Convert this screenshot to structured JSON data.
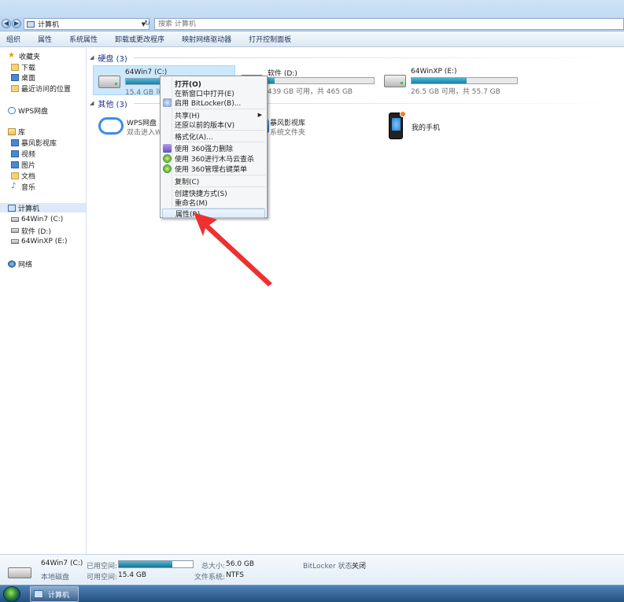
{
  "window": {
    "breadcrumb": "计算机",
    "search_placeholder": "搜索 计算机"
  },
  "toolbar": {
    "items": [
      "组织",
      "属性",
      "系统属性",
      "卸载或更改程序",
      "映射网络驱动器",
      "打开控制面板"
    ]
  },
  "navpane": {
    "favorites": {
      "title": "收藏夹",
      "items": [
        "下载",
        "桌面",
        "最近访问的位置"
      ]
    },
    "wps": "WPS网盘",
    "libraries": {
      "title": "库",
      "items": [
        "暴风影视库",
        "视频",
        "图片",
        "文档",
        "音乐"
      ]
    },
    "computer": {
      "title": "计算机",
      "items": [
        "64Win7 (C:)",
        "软件 (D:)",
        "64WinXP (E:)"
      ]
    },
    "network": "网络"
  },
  "content": {
    "hard_disks_header": "硬盘 (3)",
    "drives": [
      {
        "name": "64Win7 (C:)",
        "free_text": "15.4 GB 可",
        "used_fraction": 0.72
      },
      {
        "name": "软件 (D:)",
        "free_text": "439 GB 可用，共 465 GB",
        "used_fraction": 0.06
      },
      {
        "name": "64WinXP (E:)",
        "free_text": "26.5 GB 可用，共 55.7 GB",
        "used_fraction": 0.52
      }
    ],
    "other_header": "其他 (3)",
    "others": [
      {
        "name": "WPS网盘",
        "sub": "双击进入W"
      },
      {
        "name": "暴风影视库",
        "sub": "系统文件夹"
      },
      {
        "name": "我的手机",
        "sub": ""
      }
    ]
  },
  "context_menu": {
    "items": [
      {
        "label": "打开(O)",
        "bold": true
      },
      {
        "label": "在新窗口中打开(E)"
      },
      {
        "label": "启用 BitLocker(B)..."
      },
      {
        "label": "共享(H)",
        "submenu": true
      },
      {
        "label": "还原以前的版本(V)"
      },
      {
        "label": "格式化(A)..."
      },
      {
        "label": "使用 360强力删除"
      },
      {
        "label": "使用 360进行木马云查杀"
      },
      {
        "label": "使用 360管理右键菜单"
      },
      {
        "label": "复制(C)"
      },
      {
        "label": "创建快捷方式(S)"
      },
      {
        "label": "重命名(M)"
      },
      {
        "label": "属性(R)"
      }
    ]
  },
  "details": {
    "drive_name": "64Win7 (C:)",
    "drive_type": "本地磁盘",
    "used_label": "已用空间:",
    "free_label": "可用空间:",
    "free_value": "15.4 GB",
    "used_fraction": 0.72,
    "total_label": "总大小:",
    "total_value": "56.0 GB",
    "fs_label": "文件系统:",
    "fs_value": "NTFS",
    "bitlocker_label": "BitLocker 状态:",
    "bitlocker_value": "关闭"
  },
  "taskbar": {
    "window_label": "计算机"
  },
  "colors": {
    "accent": "#1e3287",
    "annotation_arrow": "#ee3030",
    "drive_bar": "#1a7fa8"
  }
}
